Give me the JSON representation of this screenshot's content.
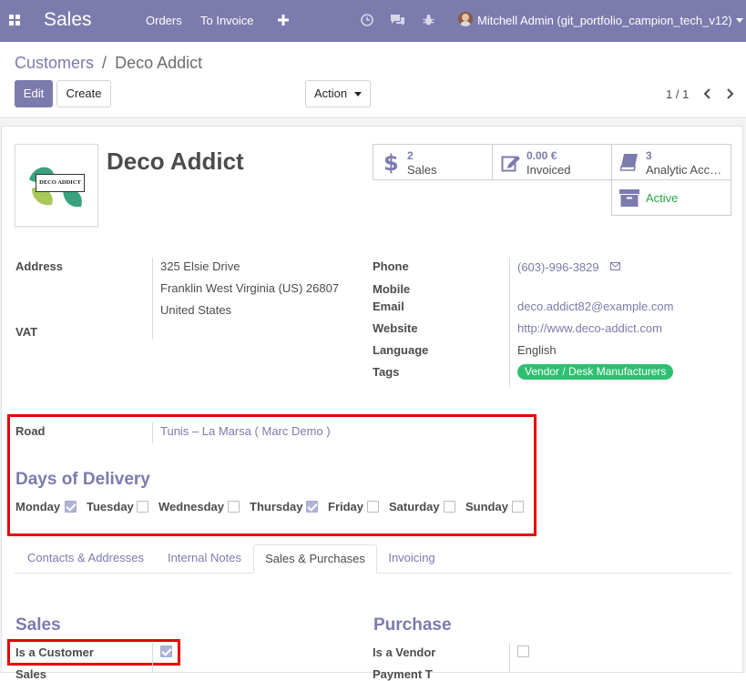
{
  "navbar": {
    "app_title": "Sales",
    "menu": [
      "Orders",
      "To Invoice"
    ],
    "user": "Mitchell Admin (git_portfolio_campion_tech_v12)"
  },
  "control": {
    "breadcrumb_parent": "Customers",
    "breadcrumb_sep": "/",
    "breadcrumb_current": "Deco Addict",
    "edit_label": "Edit",
    "create_label": "Create",
    "action_label": "Action",
    "pager": "1 / 1"
  },
  "partner": {
    "name": "Deco Addict",
    "logo_text": "DECO ADDICT"
  },
  "stats": {
    "sales_count": "2",
    "sales_label": "Sales",
    "invoiced_amount": "0.00 €",
    "invoiced_label": "Invoiced",
    "analytic_count": "3",
    "analytic_label": "Analytic Acc…",
    "active_label": "Active"
  },
  "fields": {
    "address_label": "Address",
    "street": "325 Elsie Drive",
    "city_line": "Franklin West Virginia (US) 26807",
    "country": "United States",
    "vat_label": "VAT",
    "phone_label": "Phone",
    "phone": "(603)-996-3829",
    "mobile_label": "Mobile",
    "email_label": "Email",
    "email": "deco.addict82@example.com",
    "website_label": "Website",
    "website": "http://www.deco-addict.com",
    "language_label": "Language",
    "language": "English",
    "tags_label": "Tags",
    "tag": "Vendor / Desk Manufacturers",
    "road_label": "Road",
    "road": "Tunis – La Marsa ( Marc Demo )"
  },
  "delivery": {
    "title": "Days of Delivery",
    "days": [
      {
        "label": "Monday",
        "checked": true
      },
      {
        "label": "Tuesday",
        "checked": false
      },
      {
        "label": "Wednesday",
        "checked": false
      },
      {
        "label": "Thursday",
        "checked": true
      },
      {
        "label": "Friday",
        "checked": false
      },
      {
        "label": "Saturday",
        "checked": false
      },
      {
        "label": "Sunday",
        "checked": false
      }
    ]
  },
  "tabs": [
    "Contacts & Addresses",
    "Internal Notes",
    "Sales & Purchases",
    "Invoicing"
  ],
  "active_tab": "Sales & Purchases",
  "sales_section": {
    "title": "Sales",
    "is_customer_label": "Is a Customer",
    "is_customer": true,
    "next_label_partial": "Sales"
  },
  "purchase_section": {
    "title": "Purchase",
    "is_vendor_label": "Is a Vendor",
    "is_vendor": false,
    "next_label_partial": "Payment T"
  },
  "colors": {
    "brand": "#7c7bad",
    "active_green": "#28a745",
    "tag_green": "#2fbf71",
    "highlight_red": "#e60000"
  }
}
